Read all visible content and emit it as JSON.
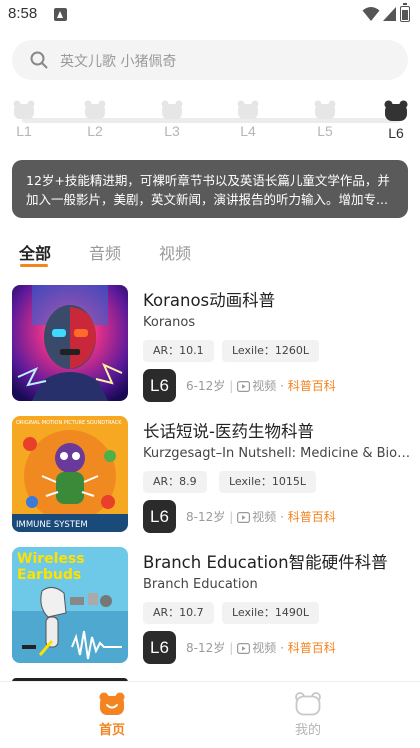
{
  "status_bar": {
    "time": "8:58"
  },
  "search": {
    "placeholder": "英文儿歌 小猪佩奇"
  },
  "levels": {
    "items": [
      {
        "label": "L1",
        "active": false
      },
      {
        "label": "L2",
        "active": false
      },
      {
        "label": "L3",
        "active": false
      },
      {
        "label": "L4",
        "active": false
      },
      {
        "label": "L5",
        "active": false
      },
      {
        "label": "L6",
        "active": true
      }
    ],
    "description": "12岁+技能精进期，可裸听章节书以及英语长篇儿童文学作品，并加入一般影片，美剧，英文新闻，演讲报告的听力输入。增加专..."
  },
  "tabs": [
    {
      "label": "全部",
      "active": true
    },
    {
      "label": "音频",
      "active": false
    },
    {
      "label": "视频",
      "active": false
    }
  ],
  "items": [
    {
      "title": "Koranos动画科普",
      "author": "Koranos",
      "ar": "AR：10.1",
      "lexile": "Lexile：1260L",
      "level": "L6",
      "age": "6-12岁",
      "media": "视频",
      "category": "科普百科"
    },
    {
      "title": "长话短说-医药生物科普",
      "author": "Kurzgesagt–In Nutshell: Medicine & Biology",
      "ar": "AR：8.9",
      "lexile": "Lexile：1015L",
      "level": "L6",
      "age": "8-12岁",
      "media": "视频",
      "category": "科普百科",
      "thumb_text_top": "ORIGINAL MOTION PICTURE SOUNDTRACK",
      "thumb_text_bottom": "IMMUNE SYSTEM"
    },
    {
      "title": "Branch Education智能硬件科普",
      "author": "Branch Education",
      "ar": "AR：10.7",
      "lexile": "Lexile：1490L",
      "level": "L6",
      "age": "8-12岁",
      "media": "视频",
      "category": "科普百科",
      "thumb_text_line1": "Wireless",
      "thumb_text_line2": "Earbuds"
    }
  ],
  "bottom_nav": [
    {
      "label": "首页",
      "active": true
    },
    {
      "label": "我的",
      "active": false
    }
  ],
  "colors": {
    "accent": "#f5831f",
    "desc_bg": "#5a5a5a",
    "badge_bg": "#2b2b2b"
  }
}
